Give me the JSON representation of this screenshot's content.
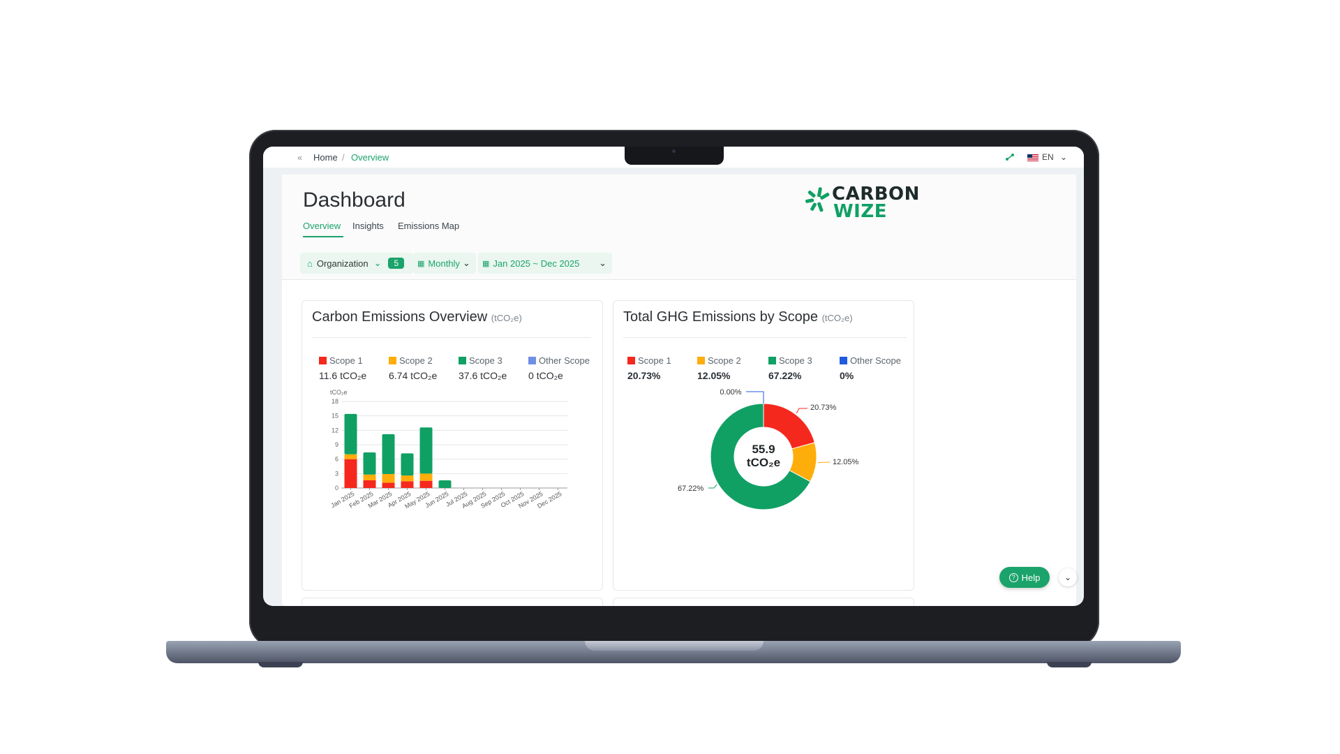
{
  "breadcrumb": {
    "collapse_icon": "double-chevron-left-icon",
    "home": "Home",
    "separator": "/",
    "current": "Overview"
  },
  "topbar": {
    "language": "EN",
    "flag_icon": "us-flag-icon",
    "share_icon": "share-icon"
  },
  "page": {
    "title": "Dashboard",
    "tabs": [
      {
        "label": "Overview",
        "active": true
      },
      {
        "label": "Insights",
        "active": false
      },
      {
        "label": "Emissions Map",
        "active": false
      }
    ]
  },
  "logo": {
    "line1": "CARBON",
    "line2": "WIZE"
  },
  "filters": {
    "organization": {
      "icon": "home-icon",
      "label": "Organization",
      "count": "5"
    },
    "period": {
      "icon": "calendar-icon",
      "label": "Monthly"
    },
    "date_range": {
      "icon": "calendar-icon",
      "label": "Jan 2025 ~ Dec 2025"
    }
  },
  "colors": {
    "scope1": "#f5281e",
    "scope2": "#ffad0a",
    "scope3": "#10a064",
    "other": "#6f8fe6",
    "other_pie": "#1f5ae0",
    "accent": "#1aa36a"
  },
  "overview_card": {
    "title": "Carbon Emissions Overview",
    "unit": "(tCO₂e)",
    "legend": [
      {
        "label": "Scope 1",
        "value": "11.6",
        "unit": "tCO₂e"
      },
      {
        "label": "Scope 2",
        "value": "6.74",
        "unit": "tCO₂e"
      },
      {
        "label": "Scope 3",
        "value": "37.6",
        "unit": "tCO₂e"
      },
      {
        "label": "Other Scope",
        "value": "0",
        "unit": "tCO₂e"
      }
    ]
  },
  "scope_card": {
    "title": "Total GHG Emissions by Scope",
    "unit": "(tCO₂e)",
    "legend": [
      {
        "label": "Scope 1",
        "value": "20.73%"
      },
      {
        "label": "Scope 2",
        "value": "12.05%"
      },
      {
        "label": "Scope 3",
        "value": "67.22%"
      },
      {
        "label": "Other Scope",
        "value": "0%"
      }
    ],
    "center_value": "55.9",
    "center_unit": "tCO₂e"
  },
  "help": {
    "label": "Help",
    "icon": "question-circle-icon"
  },
  "chart_data": [
    {
      "type": "bar",
      "stacked": true,
      "ylabel": "tCO₂e",
      "ylim": [
        0,
        18
      ],
      "yticks": [
        0,
        3,
        6,
        9,
        12,
        15,
        18
      ],
      "grid": true,
      "categories": [
        "Jan 2025",
        "Feb 2025",
        "Mar 2025",
        "Apr 2025",
        "May 2025",
        "Jun 2025",
        "Jul 2025",
        "Aug 2025",
        "Sep 2025",
        "Oct 2025",
        "Nov 2025",
        "Dec 2025"
      ],
      "series": [
        {
          "name": "Scope 1",
          "values": [
            6.0,
            1.6,
            1.1,
            1.4,
            1.5,
            0,
            0,
            0,
            0,
            0,
            0,
            0
          ]
        },
        {
          "name": "Scope 2",
          "values": [
            1.0,
            1.2,
            1.8,
            1.2,
            1.5,
            0,
            0,
            0,
            0,
            0,
            0,
            0
          ]
        },
        {
          "name": "Scope 3",
          "values": [
            8.4,
            4.6,
            8.3,
            4.6,
            9.6,
            1.6,
            0,
            0,
            0,
            0,
            0,
            0
          ]
        }
      ]
    },
    {
      "type": "pie",
      "donut": true,
      "categories": [
        "Other Scope",
        "Scope 1",
        "Scope 2",
        "Scope 3"
      ],
      "values": [
        0.0,
        20.73,
        12.05,
        67.22
      ],
      "labels": [
        "0.00%",
        "20.73%",
        "12.05%",
        "67.22%"
      ]
    }
  ]
}
